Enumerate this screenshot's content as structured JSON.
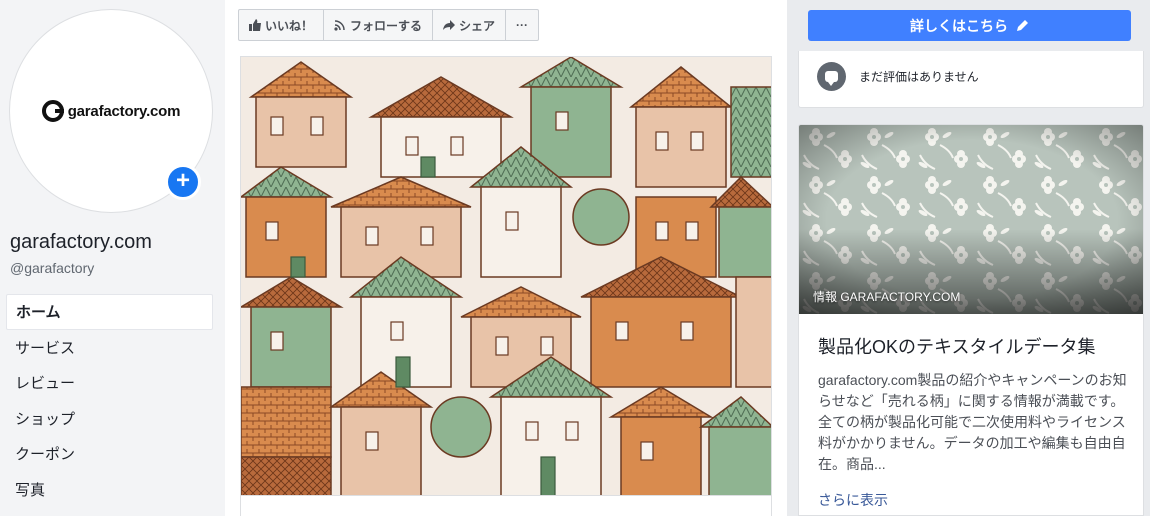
{
  "profile": {
    "logo_text": "garafactory.com",
    "name": "garafactory.com",
    "handle": "@garafactory",
    "add_photo_icon": "+"
  },
  "nav": {
    "items": [
      {
        "label": "ホーム",
        "active": true
      },
      {
        "label": "サービス"
      },
      {
        "label": "レビュー"
      },
      {
        "label": "ショップ"
      },
      {
        "label": "クーポン"
      },
      {
        "label": "写真"
      }
    ]
  },
  "actions": {
    "like_icon": "like-icon",
    "like_label": "いいね！",
    "follow_icon": "rss-icon",
    "follow_label": "フォローする",
    "share_icon": "share-arrow-icon",
    "share_label": "シェア",
    "more_label": "···"
  },
  "cta": {
    "label": "詳しくはこちら",
    "icon": "pencil-icon",
    "color": "#4080ff"
  },
  "rating": {
    "text": "まだ評価はありません"
  },
  "info": {
    "source": "情報 GARAFACTORY.COM",
    "title": "製品化OKのテキスタイルデータ集",
    "description": "garafactory.com製品の紹介やキャンペーンのお知らせなど「売れる柄」に関する情報が満載です。全ての柄が製品化可能で二次使用料やライセンス料がかかりません。データの加工や編集も自由自在。商品...",
    "more_label": "さらに表示"
  },
  "colors": {
    "brand_blue": "#1877f2",
    "link": "#385898",
    "house_green": "#8fb491",
    "house_orange": "#d98b4e",
    "house_brick": "#b86a3c",
    "house_pink": "#e8c3a8",
    "pattern_bg": "#b8c4bc"
  }
}
